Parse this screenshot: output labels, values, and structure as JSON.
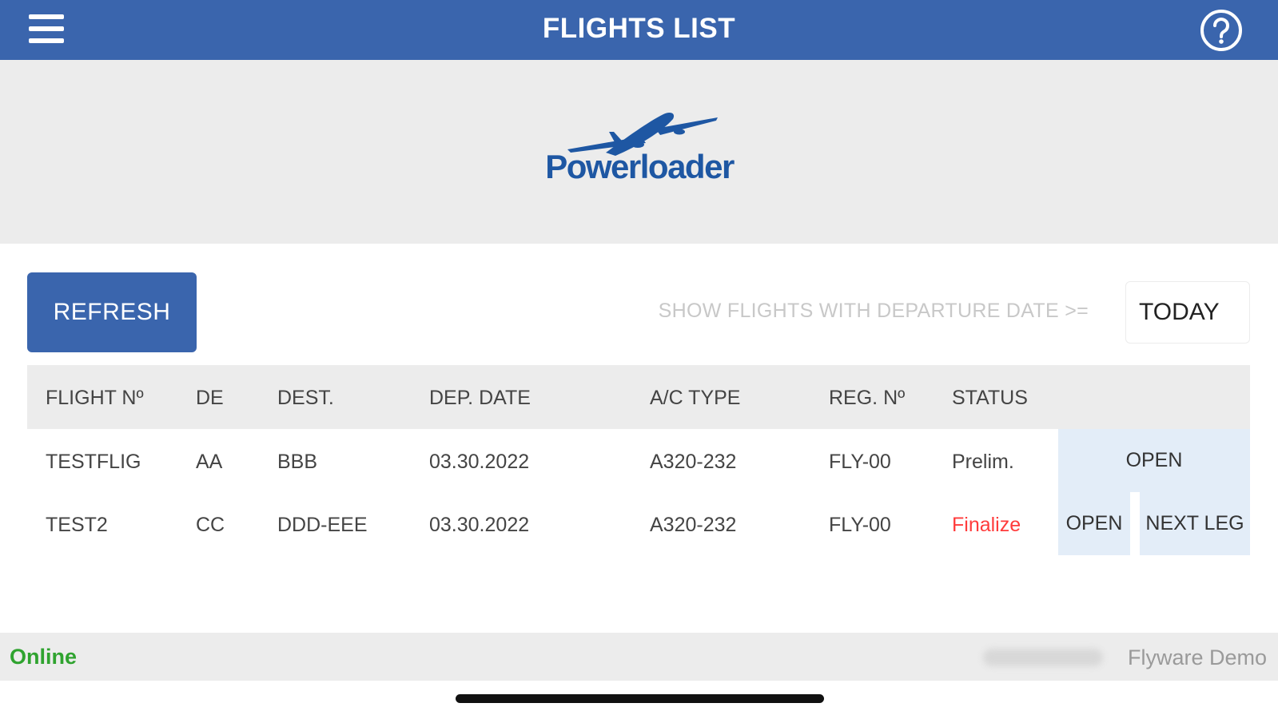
{
  "header": {
    "title": "FLIGHTS LIST",
    "menu_icon": "hamburger-menu-icon",
    "help_icon": "help-circle-icon",
    "background_color": "#3a65ad"
  },
  "logo": {
    "text": "Powerloader",
    "icon": "airplane-icon",
    "color": "#1e57a3"
  },
  "controls": {
    "refresh_label": "REFRESH",
    "filter_label": "SHOW FLIGHTS WITH DEPARTURE DATE >=",
    "date_filter_value": "TODAY"
  },
  "table": {
    "columns": [
      "FLIGHT Nº",
      "DE",
      "DEST.",
      "DEP. DATE",
      "A/C TYPE",
      "REG. Nº",
      "STATUS"
    ],
    "rows": [
      {
        "flight_no": "TESTFLIG",
        "de": "AA",
        "dest": "BBB",
        "dep_date": "03.30.2022",
        "ac_type": "A320-232",
        "reg_no": "FLY-00",
        "status": "Prelim.",
        "actions": [
          "OPEN"
        ]
      },
      {
        "flight_no": "TEST2",
        "de": "CC",
        "dest": "DDD-EEE",
        "dep_date": "03.30.2022",
        "ac_type": "A320-232",
        "reg_no": "FLY-00",
        "status": "Finalize",
        "actions": [
          "OPEN",
          "NEXT LEG"
        ]
      }
    ],
    "status_colors": {
      "Prelim.": "#444444",
      "Finalize": "#ff3b3b"
    },
    "action_background": "#e3edf8"
  },
  "status_bar": {
    "connection": "Online",
    "connection_color": "#2fa32f",
    "environment": "Flyware Demo"
  }
}
